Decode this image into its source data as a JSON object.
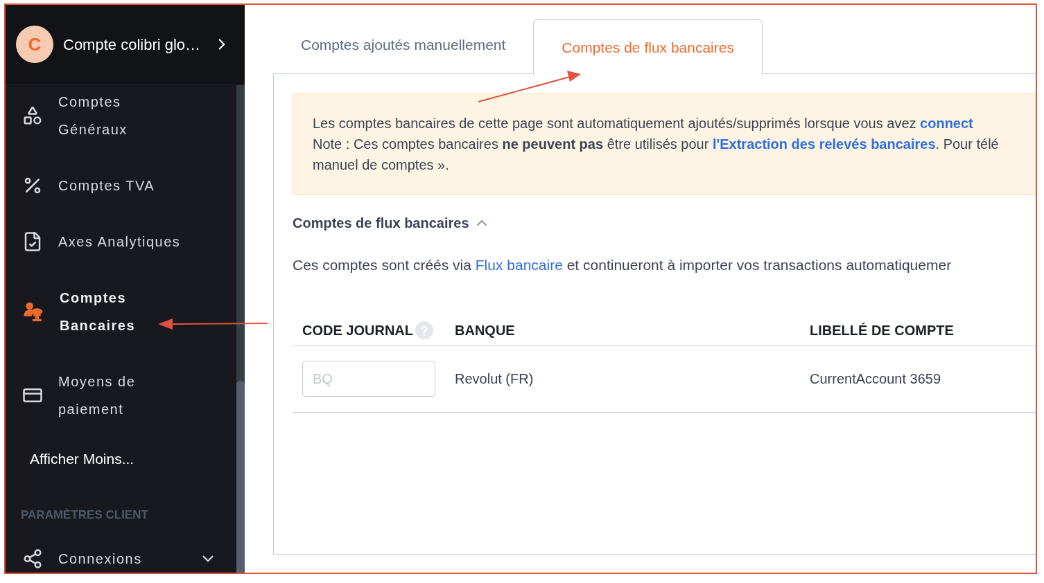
{
  "account": {
    "initial": "C",
    "name": "Compte colibri glo…"
  },
  "sidebar": {
    "items": [
      {
        "kind": "shapes",
        "label": "Comptes\nGénéraux",
        "selected": false
      },
      {
        "kind": "percent",
        "label": "Comptes TVA",
        "selected": false
      },
      {
        "kind": "file-check",
        "label": "Axes Analytiques",
        "selected": false
      },
      {
        "kind": "people",
        "label": "Comptes\nBancaires",
        "selected": true
      },
      {
        "kind": "cards",
        "label": "Moyens de\npaiement",
        "selected": false
      }
    ],
    "toggle": "Afficher Moins...",
    "section": {
      "title": "PARAMÈTRES CLIENT",
      "items": [
        {
          "kind": "connections",
          "label": "Connexions",
          "expanded": false
        }
      ]
    }
  },
  "tabs": [
    {
      "label": "Comptes ajoutés manuellement",
      "selected": false
    },
    {
      "label": "Comptes de flux bancaires",
      "selected": true
    }
  ],
  "notice": {
    "lines": [
      [
        {
          "kind": "text",
          "text": "Les comptes bancaires de cette page sont automatiquement ajoutés/supprimés lorsque vous avez "
        },
        {
          "kind": "link",
          "text": "connect"
        }
      ],
      [
        {
          "kind": "text",
          "text": "Note : Ces comptes bancaires **ne peuvent pas** être utilisés pour "
        },
        {
          "kind": "link",
          "text": "l'Extraction des relevés bancaires"
        },
        {
          "kind": "text",
          "text": ". Pour télé"
        }
      ],
      [
        {
          "kind": "text",
          "text": "manuel de comptes »."
        }
      ]
    ]
  },
  "section": {
    "title": "Comptes de flux bancaires",
    "expanded": true,
    "description": [
      {
        "kind": "text",
        "text": "Ces comptes sont créés via "
      },
      {
        "kind": "link",
        "text": "Flux bancaire"
      },
      {
        "kind": "text",
        "text": " et continueront à importer vos transactions automatiquemer"
      }
    ]
  },
  "table": {
    "columns": [
      {
        "label": "CODE JOURNAL",
        "help": true
      },
      {
        "label": "BANQUE",
        "help": false
      },
      {
        "label": "LIBELLÉ DE COMPTE",
        "help": false
      }
    ],
    "rows": [
      {
        "code_placeholder": "BQ",
        "bank": "Revolut (FR)",
        "account": "CurrentAccount 3659"
      }
    ]
  }
}
